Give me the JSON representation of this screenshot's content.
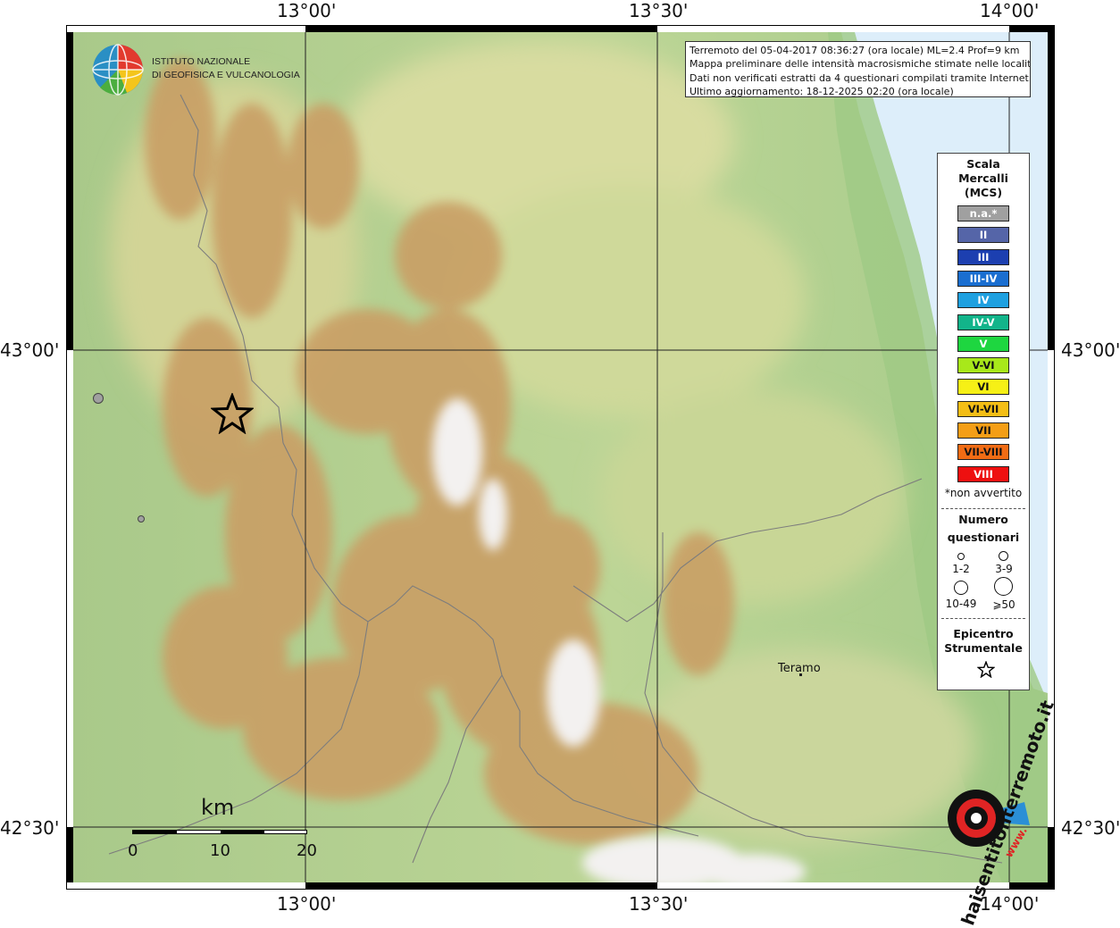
{
  "info": {
    "line1": "Terremoto del 05-04-2017 08:36:27 (ora locale) ML=2.4 Prof=9 km",
    "line2": "Mappa preliminare delle intensità macrosismiche stimate nelle località",
    "line3": "Dati non verificati estratti da 4 questionari compilati tramite Internet.",
    "line4": "Ultimo aggiornamento: 18-12-2025 02:20 (ora locale)"
  },
  "logo": {
    "line1": "ISTITUTO NAZIONALE",
    "line2": "DI GEOFISICA E VULCANOLOGIA"
  },
  "axes": {
    "top": [
      "13°00'",
      "13°30'",
      "14°00'"
    ],
    "bottom": [
      "13°00'",
      "13°30'",
      "14°00'"
    ],
    "left": [
      "43°00'",
      "42°30'"
    ],
    "right": [
      "43°00'",
      "42°30'"
    ]
  },
  "legend": {
    "title1": "Scala",
    "title2": "Mercalli",
    "title3": "(MCS)",
    "classes": [
      {
        "label": "n.a.*",
        "color": "#a0a0a0"
      },
      {
        "label": "II",
        "color": "#5565a8"
      },
      {
        "label": "III",
        "color": "#1c3fb0"
      },
      {
        "label": "III-IV",
        "color": "#1a6ed0"
      },
      {
        "label": "IV",
        "color": "#1ea0e0"
      },
      {
        "label": "IV-V",
        "color": "#12b48a"
      },
      {
        "label": "V",
        "color": "#1ed640"
      },
      {
        "label": "V-VI",
        "color": "#a8e81a"
      },
      {
        "label": "VI",
        "color": "#f6f016"
      },
      {
        "label": "VI-VII",
        "color": "#f4be16"
      },
      {
        "label": "VII",
        "color": "#f49e16"
      },
      {
        "label": "VII-VIII",
        "color": "#f26c14"
      },
      {
        "label": "VIII",
        "color": "#ee1010"
      }
    ],
    "not_felt_note": "*non avvertito",
    "questionnaires_title1": "Numero",
    "questionnaires_title2": "questionari",
    "size_classes": [
      "1-2",
      "3-9",
      "10-49",
      "⩾50"
    ],
    "epicenter_title1": "Epicentro",
    "epicenter_title2": "Strumentale"
  },
  "places": {
    "city": "Teramo"
  },
  "scale": {
    "unit": "km",
    "labels": [
      "0",
      "10",
      "20"
    ]
  },
  "watermark": {
    "text": "haisentitoilterremoto.it",
    "www": "www."
  },
  "colors": {
    "sea": "#ddeefa",
    "lowland": "#b6d18e",
    "mountain": "#c79c5f",
    "peak": "#f4f2f1"
  }
}
